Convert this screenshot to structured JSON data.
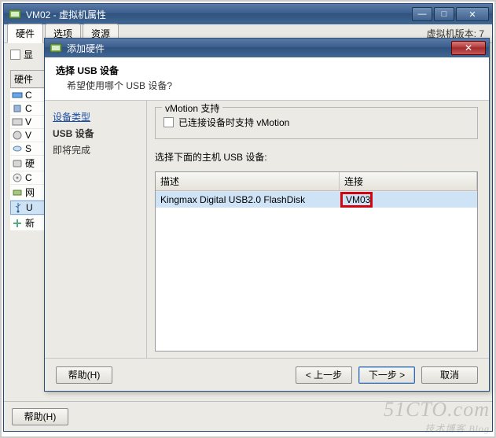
{
  "parent": {
    "title": "VM02 - 虚拟机属性",
    "tabs": [
      "硬件",
      "选项",
      "资源"
    ],
    "version": "虚拟机版本: 7",
    "show_all_checkbox": "显",
    "hw_header": "硬件",
    "items": [
      {
        "icon": "memory-icon",
        "label": "C"
      },
      {
        "icon": "cpu-icon",
        "label": "C"
      },
      {
        "icon": "video-icon",
        "label": "V"
      },
      {
        "icon": "vmci-icon",
        "label": "V"
      },
      {
        "icon": "scsi-icon",
        "label": "S"
      },
      {
        "icon": "disk-icon",
        "label": "硬"
      },
      {
        "icon": "cd-icon",
        "label": "C"
      },
      {
        "icon": "nic-icon",
        "label": "网"
      },
      {
        "icon": "usb-icon",
        "label": "U",
        "selected": true
      },
      {
        "icon": "add-icon",
        "label": "新"
      }
    ],
    "help_btn": "帮助(H)"
  },
  "dialog": {
    "title": "添加硬件",
    "head_title": "选择 USB 设备",
    "head_sub": "希望使用哪个 USB 设备?",
    "steps": {
      "type": "设备类型",
      "usb": "USB 设备",
      "finish": "即将完成"
    },
    "vmotion_legend": "vMotion 支持",
    "vmotion_checkbox": "已连接设备时支持 vMotion",
    "select_label": "选择下面的主机 USB 设备:",
    "columns": {
      "desc": "描述",
      "conn": "连接"
    },
    "rows": [
      {
        "desc": "Kingmax Digital USB2.0 FlashDisk",
        "conn": "VM03"
      }
    ],
    "buttons": {
      "help": "帮助(H)",
      "back": "< 上一步",
      "next": "下一步 >",
      "cancel": "取消"
    }
  },
  "watermark": {
    "main": "51CTO.com",
    "sub": "技术博客  Blog"
  }
}
